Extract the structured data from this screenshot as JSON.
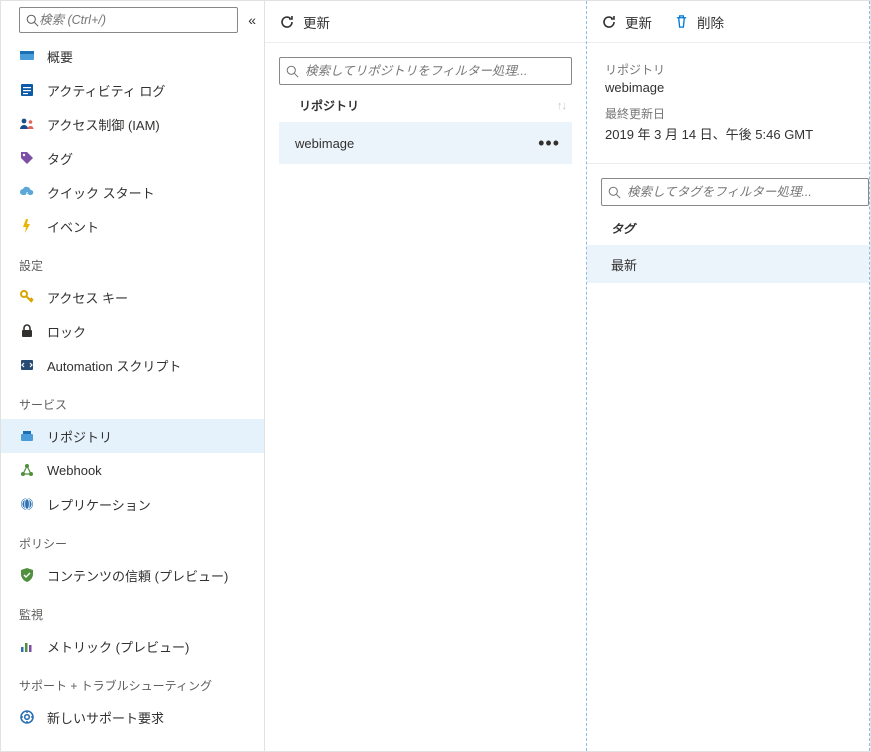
{
  "sidebar": {
    "search_placeholder": "検索 (Ctrl+/)",
    "items": [
      {
        "label": "概要"
      },
      {
        "label": "アクティビティ ログ"
      },
      {
        "label": "アクセス制御 (IAM)"
      },
      {
        "label": "タグ"
      },
      {
        "label": "クイック スタート"
      },
      {
        "label": "イベント"
      }
    ],
    "sections": {
      "settings": {
        "title": "設定",
        "items": [
          {
            "label": "アクセス キー"
          },
          {
            "label": "ロック"
          },
          {
            "label": "Automation スクリプト"
          }
        ]
      },
      "services": {
        "title": "サービス",
        "items": [
          {
            "label": "リポジトリ"
          },
          {
            "label": "Webhook"
          },
          {
            "label": "レプリケーション"
          }
        ]
      },
      "policy": {
        "title": "ポリシー",
        "items": [
          {
            "label": "コンテンツの信頼 (プレビュー)"
          }
        ]
      },
      "monitor": {
        "title": "監視",
        "items": [
          {
            "label": "メトリック (プレビュー)"
          }
        ]
      },
      "support": {
        "title": "サポート + トラブルシューティング",
        "items": [
          {
            "label": "新しいサポート要求"
          }
        ]
      }
    }
  },
  "mid": {
    "toolbar": {
      "refresh_label": "更新"
    },
    "filter_placeholder": "検索してリポジトリをフィルター処理...",
    "list_header": "リポジトリ",
    "rows": [
      {
        "name": "webimage"
      }
    ]
  },
  "right": {
    "toolbar": {
      "refresh_label": "更新",
      "delete_label": "削除"
    },
    "repo_label": "リポジトリ",
    "repo_value": "webimage",
    "updated_label": "最終更新日",
    "updated_value": "2019 年 3 月 14 日、午後 5:46 GMT",
    "tag_filter_placeholder": "検索してタグをフィルター処理...",
    "tag_header": "タグ",
    "tags": [
      {
        "name": "最新"
      }
    ]
  }
}
